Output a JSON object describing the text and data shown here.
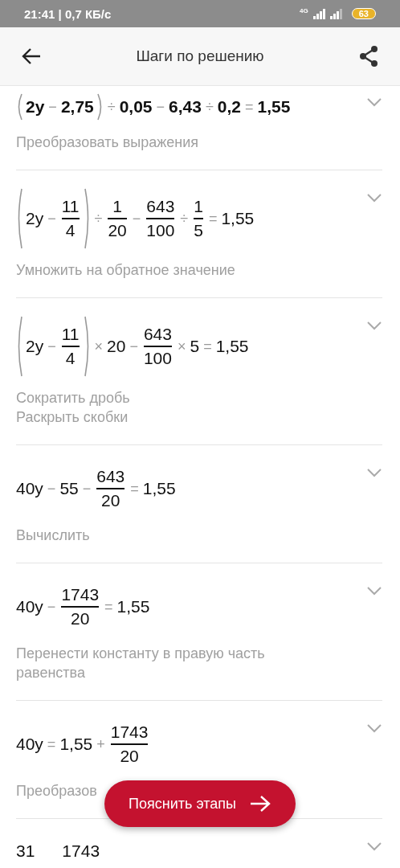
{
  "status_bar": {
    "time": "21:41 | 0,7 КБ/с",
    "network": "4G",
    "battery": "63"
  },
  "header": {
    "title": "Шаги по решению"
  },
  "steps": [
    {
      "bold": true,
      "equation": [
        {
          "kind": "paren",
          "children": [
            {
              "kind": "term",
              "text": "2y"
            },
            {
              "kind": "op",
              "text": "−"
            },
            {
              "kind": "term",
              "text": "2,75"
            }
          ]
        },
        {
          "kind": "op",
          "text": "÷"
        },
        {
          "kind": "term",
          "text": "0,05"
        },
        {
          "kind": "op",
          "text": "−"
        },
        {
          "kind": "term",
          "text": "6,43"
        },
        {
          "kind": "op",
          "text": "÷"
        },
        {
          "kind": "term",
          "text": "0,2"
        },
        {
          "kind": "op",
          "text": "="
        },
        {
          "kind": "term",
          "text": "1,55"
        }
      ],
      "description": [
        "Преобразовать выражения"
      ]
    },
    {
      "bold": false,
      "equation": [
        {
          "kind": "paren",
          "children": [
            {
              "kind": "term",
              "text": "2y"
            },
            {
              "kind": "op",
              "text": "−"
            },
            {
              "kind": "frac",
              "num": "11",
              "den": "4"
            }
          ]
        },
        {
          "kind": "op",
          "text": "÷"
        },
        {
          "kind": "frac",
          "num": "1",
          "den": "20"
        },
        {
          "kind": "op",
          "text": "−"
        },
        {
          "kind": "frac",
          "num": "643",
          "den": "100"
        },
        {
          "kind": "op",
          "text": "÷"
        },
        {
          "kind": "frac",
          "num": "1",
          "den": "5"
        },
        {
          "kind": "op",
          "text": "="
        },
        {
          "kind": "term",
          "text": "1,55"
        }
      ],
      "description": [
        "Умножить на обратное значение"
      ]
    },
    {
      "bold": false,
      "equation": [
        {
          "kind": "paren",
          "children": [
            {
              "kind": "term",
              "text": "2y"
            },
            {
              "kind": "op",
              "text": "−"
            },
            {
              "kind": "frac",
              "num": "11",
              "den": "4"
            }
          ]
        },
        {
          "kind": "op",
          "text": "×"
        },
        {
          "kind": "term",
          "text": "20"
        },
        {
          "kind": "op",
          "text": "−"
        },
        {
          "kind": "frac",
          "num": "643",
          "den": "100"
        },
        {
          "kind": "op",
          "text": "×"
        },
        {
          "kind": "term",
          "text": "5"
        },
        {
          "kind": "op",
          "text": "="
        },
        {
          "kind": "term",
          "text": "1,55"
        }
      ],
      "description": [
        "Сократить дробь",
        "Раскрыть скобки"
      ]
    },
    {
      "bold": false,
      "equation": [
        {
          "kind": "term",
          "text": "40y"
        },
        {
          "kind": "op",
          "text": "−"
        },
        {
          "kind": "term",
          "text": "55"
        },
        {
          "kind": "op",
          "text": "−"
        },
        {
          "kind": "frac",
          "num": "643",
          "den": "20"
        },
        {
          "kind": "op",
          "text": "="
        },
        {
          "kind": "term",
          "text": "1,55"
        }
      ],
      "description": [
        "Вычислить"
      ]
    },
    {
      "bold": false,
      "equation": [
        {
          "kind": "term",
          "text": "40y"
        },
        {
          "kind": "op",
          "text": "−"
        },
        {
          "kind": "frac",
          "num": "1743",
          "den": "20"
        },
        {
          "kind": "op",
          "text": "="
        },
        {
          "kind": "term",
          "text": "1,55"
        }
      ],
      "description": [
        "Перенести константу в правую часть равенства"
      ]
    },
    {
      "bold": false,
      "equation": [
        {
          "kind": "term",
          "text": "40y"
        },
        {
          "kind": "op",
          "text": "="
        },
        {
          "kind": "term",
          "text": "1,55"
        },
        {
          "kind": "op",
          "text": "+"
        },
        {
          "kind": "frac",
          "num": "1743",
          "den": "20"
        }
      ],
      "description": [
        "Преобразов"
      ]
    },
    {
      "bold": false,
      "equation": [
        {
          "kind": "num",
          "text": "31"
        },
        {
          "kind": "num",
          "text": "1743"
        }
      ]
    }
  ],
  "action_button": {
    "label": "Пояснить этапы"
  }
}
